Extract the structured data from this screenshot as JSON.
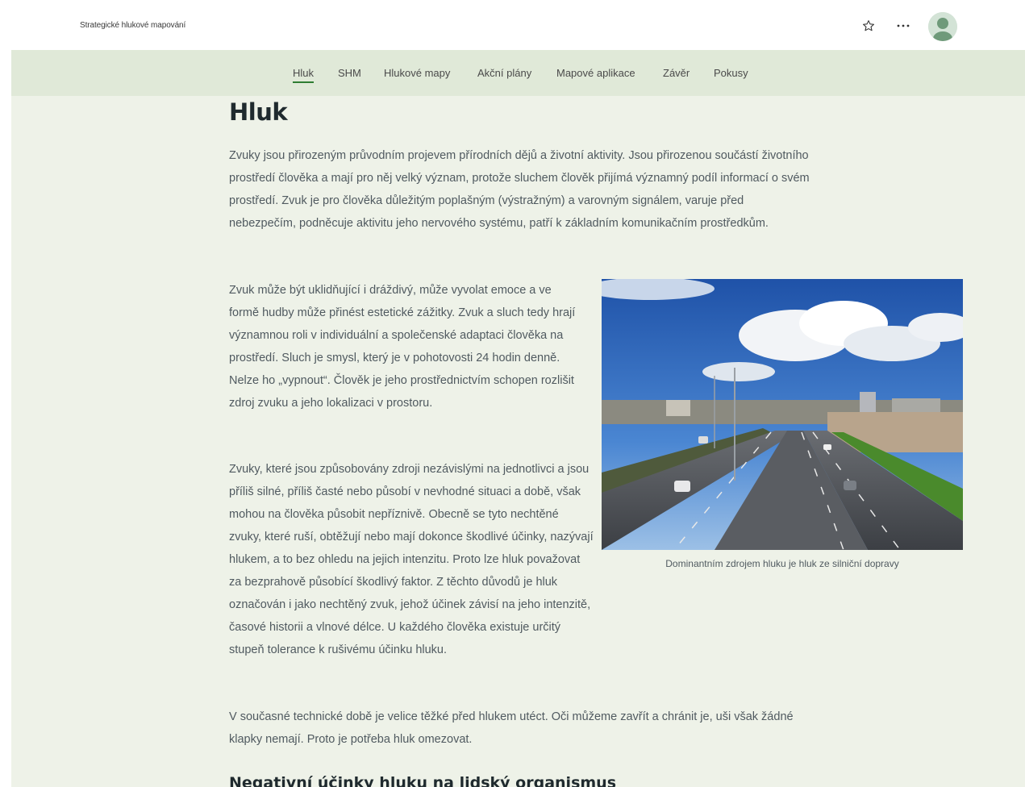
{
  "header": {
    "site_title": "Strategické hlukové mapování",
    "star_icon": "star-icon",
    "more_icon": "more-icon",
    "avatar_icon": "user-avatar-icon"
  },
  "nav": {
    "items": [
      "Hluk",
      "SHM",
      "Hlukové mapy",
      "Akční plány",
      "Mapové aplikace",
      "Závěr",
      "Pokusy"
    ],
    "active": "Hluk"
  },
  "main": {
    "title": "Hluk",
    "p1": "Zvuky jsou přirozeným průvodním projevem přírodních dějů a životní aktivity. Jsou přirozenou součástí životního prostředí člověka a mají pro něj velký význam, protože sluchem člověk přijímá významný podíl informací o svém prostředí. Zvuk je pro člověka důležitým poplašným (výstražným) a varovným signálem, varuje před nebezpečím, podněcuje aktivitu jeho nervového systému, patří k základním komunikačním prostředkům.",
    "p2": "Zvuk může být uklidňující i dráždivý, může vyvolat emoce a ve formě hudby může přinést estetické zážitky. Zvuk a sluch tedy hrají významnou roli v individuální a společenské adaptaci člověka na prostředí. Sluch je smysl, který je v pohotovosti 24 hodin denně. Nelze ho „vypnout“. Člověk je jeho prostřednictvím schopen rozlišit zdroj zvuku a jeho lokalizaci v prostoru.",
    "p3": "Zvuky, které jsou způsobovány zdroji nezávislými na jednotlivci a jsou příliš silné, příliš časté nebo působí v nevhodné situaci a době, však mohou na člověka působit nepříznivě. Obecně se tyto nechtěné zvuky, které ruší, obtěžují nebo mají dokonce škodlivé účinky, nazývají hlukem, a to bez ohledu na jejich intenzitu. Proto lze hluk považovat za bezprahově působící škodlivý faktor. Z těchto důvodů je hluk označován i jako nechtěný zvuk, jehož účinek závisí  na jeho  intenzitě, časové historii a vlnové délce. U každého člověka existuje určitý stupeň tolerance k rušivému účinku hluku.",
    "p4": "V současné technické době je velice těžké před hlukem utéct. Oči můžeme zavřít a chránit je, uši však žádné klapky nemají. Proto je potřeba hluk omezovat.",
    "figure_caption": "Dominantním zdrojem hluku je hluk ze silniční dopravy",
    "subheading": "Negativní účinky hluku na lidský organismus"
  },
  "colors": {
    "page_bg": "#eef2e8",
    "nav_bg": "#e0e9d8",
    "accent": "#2e7d32"
  }
}
